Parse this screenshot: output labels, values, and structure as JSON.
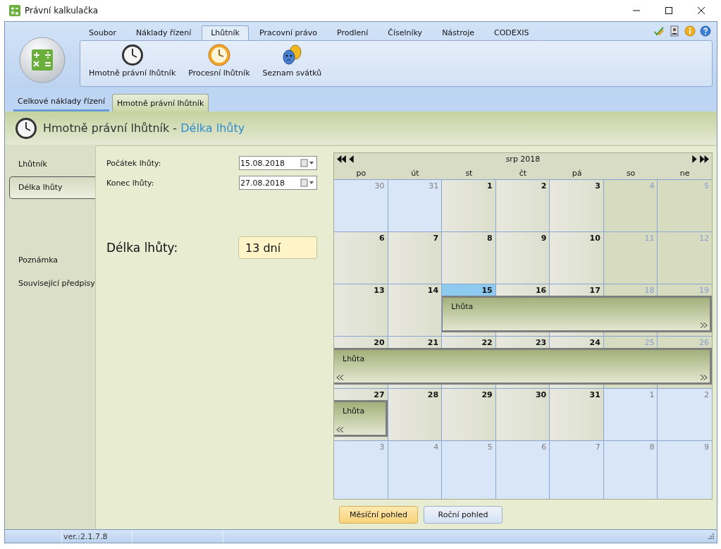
{
  "window": {
    "title": "Právní kalkulačka"
  },
  "ribbon": {
    "tabs": [
      {
        "label": "Soubor",
        "selected": false
      },
      {
        "label": "Náklady řízení",
        "selected": false
      },
      {
        "label": "Lhůtník",
        "selected": true
      },
      {
        "label": "Pracovní právo",
        "selected": false
      },
      {
        "label": "Prodlení",
        "selected": false
      },
      {
        "label": "Číselníky",
        "selected": false
      },
      {
        "label": "Nástroje",
        "selected": false
      },
      {
        "label": "CODEXIS",
        "selected": false
      }
    ],
    "buttons": [
      {
        "label": "Hmotně právní lhůtník",
        "kind": "clock"
      },
      {
        "label": "Procesní lhůtník",
        "kind": "alarm"
      },
      {
        "label": "Seznam svátků",
        "kind": "masks"
      }
    ]
  },
  "doc_tabs": [
    {
      "label": "Celkové náklady řízení",
      "selected": false
    },
    {
      "label": "Hmotně právní lhůtník",
      "selected": true
    }
  ],
  "header": {
    "title": "Hmotně právní lhůtník - ",
    "subtitle": "Délka lhůty"
  },
  "nav": {
    "items": [
      {
        "label": "Lhůtník",
        "selected": false
      },
      {
        "label": "Délka lhůty",
        "selected": true
      }
    ],
    "lower_items": [
      {
        "label": "Poznámka",
        "selected": false
      },
      {
        "label": "Související předpisy",
        "selected": false
      }
    ]
  },
  "form": {
    "fields": [
      {
        "label": "Počátek lhůty:",
        "value": "15.08.2018"
      },
      {
        "label": "Konec lhůty:",
        "value": "27.08.2018"
      }
    ],
    "result": {
      "label": "Délka lhůty:",
      "value": "13 dní"
    }
  },
  "calendar": {
    "title": "srp 2018",
    "weekdays": [
      "po",
      "út",
      "st",
      "čt",
      "pá",
      "so",
      "ne"
    ],
    "weeks": [
      {
        "days": [
          {
            "n": "30",
            "kind": "other",
            "selected": false,
            "in_event": false
          },
          {
            "n": "31",
            "kind": "other",
            "selected": false,
            "in_event": false
          },
          {
            "n": "1",
            "kind": "weekday",
            "selected": false,
            "in_event": false
          },
          {
            "n": "2",
            "kind": "weekday",
            "selected": false,
            "in_event": false
          },
          {
            "n": "3",
            "kind": "weekday",
            "selected": false,
            "in_event": false
          },
          {
            "n": "4",
            "kind": "weekend",
            "selected": false,
            "in_event": false
          },
          {
            "n": "5",
            "kind": "weekend",
            "selected": false,
            "in_event": false
          }
        ]
      },
      {
        "days": [
          {
            "n": "6",
            "kind": "weekday",
            "selected": false,
            "in_event": false
          },
          {
            "n": "7",
            "kind": "weekday",
            "selected": false,
            "in_event": false
          },
          {
            "n": "8",
            "kind": "weekday",
            "selected": false,
            "in_event": false
          },
          {
            "n": "9",
            "kind": "weekday",
            "selected": false,
            "in_event": false
          },
          {
            "n": "10",
            "kind": "weekday",
            "selected": false,
            "in_event": false
          },
          {
            "n": "11",
            "kind": "weekend",
            "selected": false,
            "in_event": false
          },
          {
            "n": "12",
            "kind": "weekend",
            "selected": false,
            "in_event": false
          }
        ]
      },
      {
        "event": {
          "label": "Lhůta",
          "continues_before": false,
          "continues_after": true
        },
        "days": [
          {
            "n": "13",
            "kind": "weekday",
            "selected": false,
            "in_event": false
          },
          {
            "n": "14",
            "kind": "weekday",
            "selected": false,
            "in_event": false
          },
          {
            "n": "15",
            "kind": "weekday",
            "selected": true,
            "in_event": true
          },
          {
            "n": "16",
            "kind": "weekday",
            "selected": false,
            "in_event": true
          },
          {
            "n": "17",
            "kind": "weekday",
            "selected": false,
            "in_event": true
          },
          {
            "n": "18",
            "kind": "weekend",
            "selected": false,
            "in_event": true
          },
          {
            "n": "19",
            "kind": "weekend",
            "selected": false,
            "in_event": true
          }
        ]
      },
      {
        "event": {
          "label": "Lhůta",
          "continues_before": true,
          "continues_after": true
        },
        "days": [
          {
            "n": "20",
            "kind": "weekday",
            "selected": false,
            "in_event": true
          },
          {
            "n": "21",
            "kind": "weekday",
            "selected": false,
            "in_event": true
          },
          {
            "n": "22",
            "kind": "weekday",
            "selected": false,
            "in_event": true
          },
          {
            "n": "23",
            "kind": "weekday",
            "selected": false,
            "in_event": true
          },
          {
            "n": "24",
            "kind": "weekday",
            "selected": false,
            "in_event": true
          },
          {
            "n": "25",
            "kind": "weekend",
            "selected": false,
            "in_event": true
          },
          {
            "n": "26",
            "kind": "weekend",
            "selected": false,
            "in_event": true
          }
        ]
      },
      {
        "event": {
          "label": "Lhůta",
          "continues_before": true,
          "continues_after": false
        },
        "days": [
          {
            "n": "27",
            "kind": "weekday",
            "selected": false,
            "in_event": true
          },
          {
            "n": "28",
            "kind": "weekday",
            "selected": false,
            "in_event": false
          },
          {
            "n": "29",
            "kind": "weekday",
            "selected": false,
            "in_event": false
          },
          {
            "n": "30",
            "kind": "weekday",
            "selected": false,
            "in_event": false
          },
          {
            "n": "31",
            "kind": "weekday",
            "selected": false,
            "in_event": false
          },
          {
            "n": "1",
            "kind": "other",
            "selected": false,
            "in_event": false
          },
          {
            "n": "2",
            "kind": "other",
            "selected": false,
            "in_event": false
          }
        ]
      },
      {
        "days": [
          {
            "n": "3",
            "kind": "other",
            "selected": false,
            "in_event": false
          },
          {
            "n": "4",
            "kind": "other",
            "selected": false,
            "in_event": false
          },
          {
            "n": "5",
            "kind": "other",
            "selected": false,
            "in_event": false
          },
          {
            "n": "6",
            "kind": "other",
            "selected": false,
            "in_event": false
          },
          {
            "n": "7",
            "kind": "other",
            "selected": false,
            "in_event": false
          },
          {
            "n": "8",
            "kind": "other",
            "selected": false,
            "in_event": false
          },
          {
            "n": "9",
            "kind": "other",
            "selected": false,
            "in_event": false
          }
        ]
      }
    ]
  },
  "view_buttons": [
    {
      "label": "Měsíční pohled",
      "selected": true
    },
    {
      "label": "Roční pohled",
      "selected": false
    }
  ],
  "status_bar": {
    "version": "ver.:2.1.7.8"
  }
}
